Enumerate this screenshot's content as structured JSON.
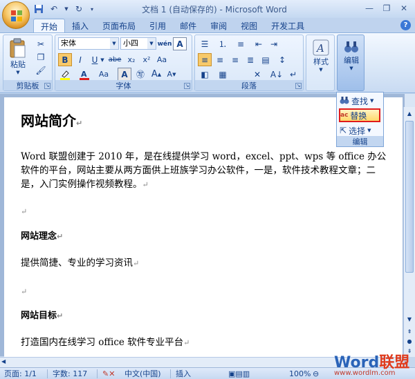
{
  "title": "文档 1 (自动保存的) - Microsoft Word",
  "tabs": [
    "开始",
    "插入",
    "页面布局",
    "引用",
    "邮件",
    "审阅",
    "视图",
    "开发工具"
  ],
  "ribbon": {
    "clipboard": {
      "paste": "粘贴",
      "label": "剪贴板"
    },
    "font": {
      "name": "宋体",
      "size": "小四",
      "label": "字体"
    },
    "paragraph": {
      "label": "段落"
    },
    "styles": {
      "label": "样式"
    },
    "editing": {
      "label": "编辑"
    }
  },
  "edit_panel": {
    "find": "查找",
    "replace": "替换",
    "select": "选择",
    "label": "编辑"
  },
  "document": {
    "heading": "网站简介",
    "para1": "Word 联盟创建于 2010 年，是在线提供学习 word，excel、ppt、wps 等 office 办公软件的平台，网站主要从两方面供上班族学习办公软件，一是，软件技术教程文章；二是，入门实例操作视频教程。",
    "h2a": "网站理念",
    "p2": "提供简捷、专业的学习资讯",
    "h2b": "网站目标",
    "p3": "打造国内在线学习 office 软件专业平台"
  },
  "status": {
    "page": "页面: 1/1",
    "words": "字数: 117",
    "lang": "中文(中国)",
    "insert": "插入",
    "zoom": "100%"
  },
  "watermark": {
    "brand_a": "Word",
    "brand_b": "联盟",
    "url": "www.wordlm.com"
  },
  "colors": {
    "accent": "#15428b",
    "highlight_box": "#e01b1b"
  }
}
